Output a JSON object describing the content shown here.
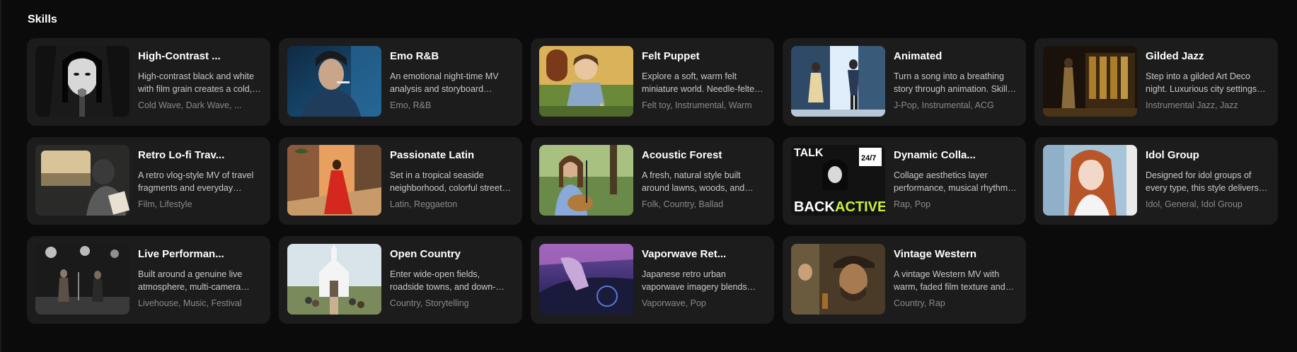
{
  "section": {
    "title": "Skills"
  },
  "skills": [
    {
      "title": "High-Contrast ...",
      "desc": "High-contrast black and white with film grain creates a cold, stark mood.",
      "tags": "Cold Wave, Dark Wave, ..."
    },
    {
      "title": "Emo R&B",
      "desc": "An emotional night-time MV analysis and storyboard generation.",
      "tags": "Emo, R&B"
    },
    {
      "title": "Felt Puppet",
      "desc": "Explore a soft, warm felt miniature world. Needle-felted characters.",
      "tags": "Felt toy, Instrumental, Warm"
    },
    {
      "title": "Animated",
      "desc": "Turn a song into a breathing story through animation. Skill for anime MVs.",
      "tags": "J-Pop, Instrumental, ACG"
    },
    {
      "title": "Gilded Jazz",
      "desc": "Step into a gilded Art Deco night. Luxurious city settings and glamour.",
      "tags": "Instrumental Jazz, Jazz"
    },
    {
      "title": "Retro Lo-fi Trav...",
      "desc": "A retro vlog-style MV of travel fragments and everyday moments.",
      "tags": "Film, Lifestyle"
    },
    {
      "title": "Passionate Latin",
      "desc": "Set in a tropical seaside neighborhood, colorful streets and dance.",
      "tags": "Latin, Reggaeton"
    },
    {
      "title": "Acoustic Forest",
      "desc": "A fresh, natural style built around lawns, woods, and sunlight.",
      "tags": "Folk, Country, Ballad"
    },
    {
      "title": "Dynamic Colla...",
      "desc": "Collage aesthetics layer performance, musical rhythm and energy.",
      "tags": "Rap, Pop"
    },
    {
      "title": "Idol Group",
      "desc": "Designed for idol groups of every type, this style delivers polish.",
      "tags": "Idol, General, Idol Group"
    },
    {
      "title": "Live Performan...",
      "desc": "Built around a genuine live atmosphere, multi-camera stage shots.",
      "tags": "Livehouse, Music, Festival"
    },
    {
      "title": "Open Country",
      "desc": "Enter wide-open fields, roadside towns, and down-home gatherings.",
      "tags": "Country, Storytelling"
    },
    {
      "title": "Vaporwave Ret...",
      "desc": "Japanese retro urban vaporwave imagery blends neon and nostalgia.",
      "tags": "Vaporwave, Pop"
    },
    {
      "title": "Vintage Western",
      "desc": "A vintage Western MV with warm, faded film texture and dust.",
      "tags": "Country, Rap"
    }
  ]
}
